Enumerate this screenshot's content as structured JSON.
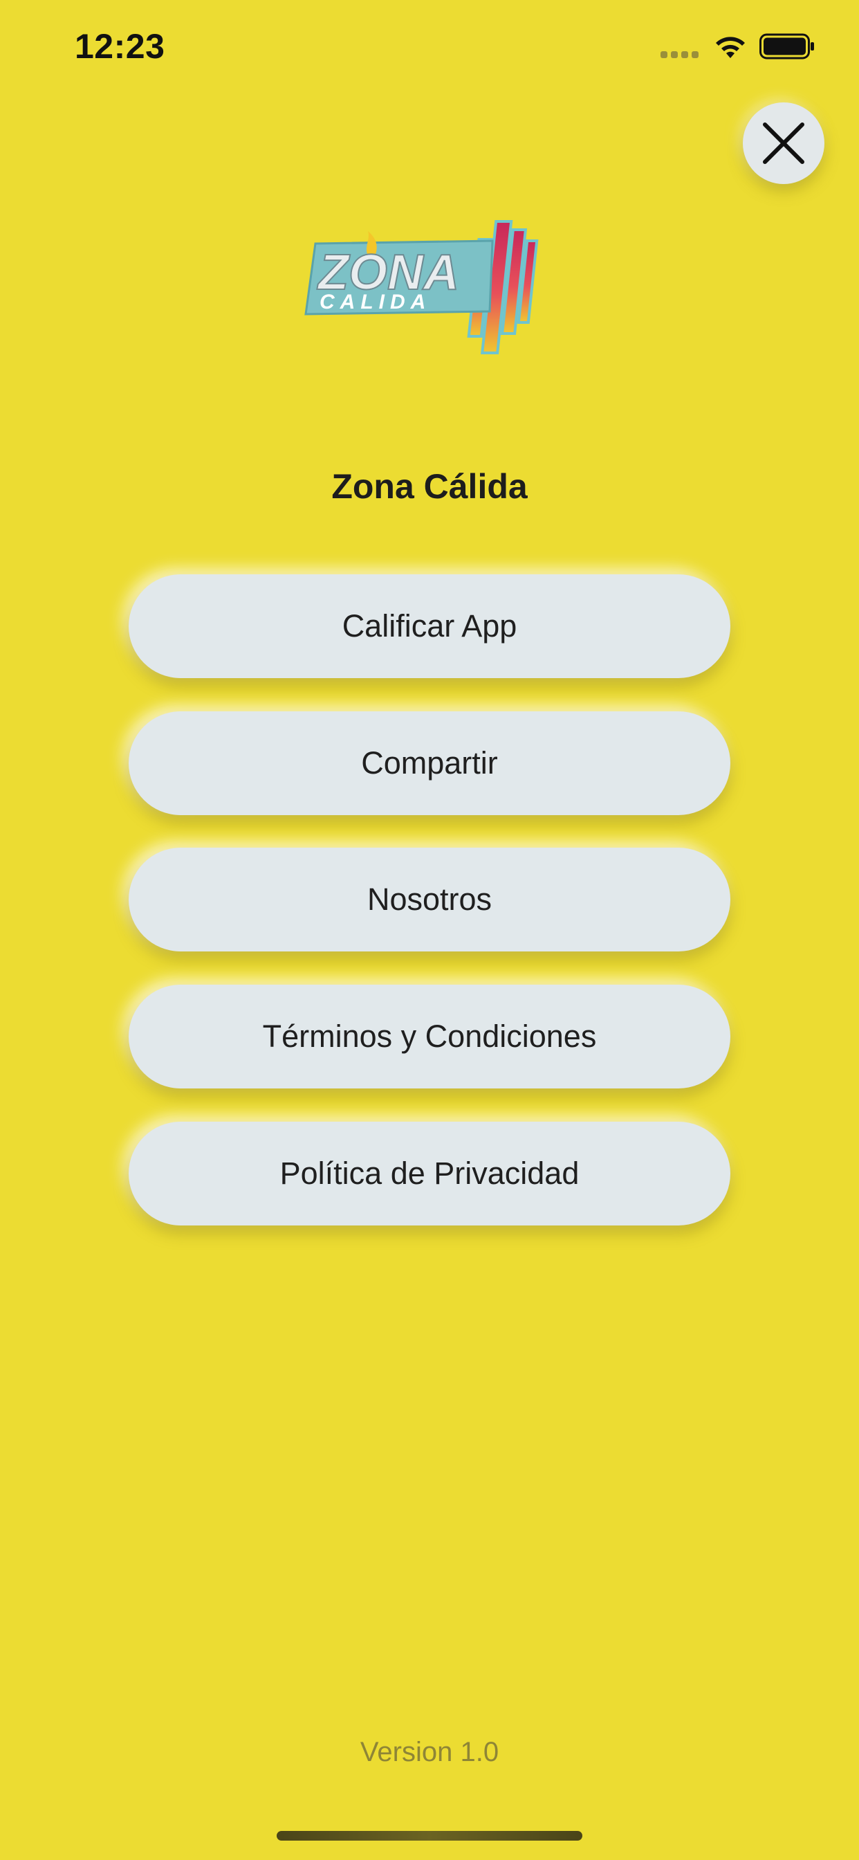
{
  "status_bar": {
    "time": "12:23"
  },
  "icons": {
    "close": "close-icon",
    "wifi": "wifi-icon",
    "battery": "battery-icon",
    "signal": "signal-icon"
  },
  "logo": {
    "line1": "ZONA",
    "line2": "CALIDA"
  },
  "title": "Zona Cálida",
  "menu": {
    "items": [
      {
        "label": "Calificar App"
      },
      {
        "label": "Compartir"
      },
      {
        "label": "Nosotros"
      },
      {
        "label": "Términos y Condiciones"
      },
      {
        "label": "Política de Privacidad"
      }
    ]
  },
  "footer": {
    "version": "Version 1.0"
  },
  "colors": {
    "background": "#ecdc32",
    "button": "#e1e8eb",
    "text": "#1f1f1f",
    "version_text": "#8e8536"
  }
}
